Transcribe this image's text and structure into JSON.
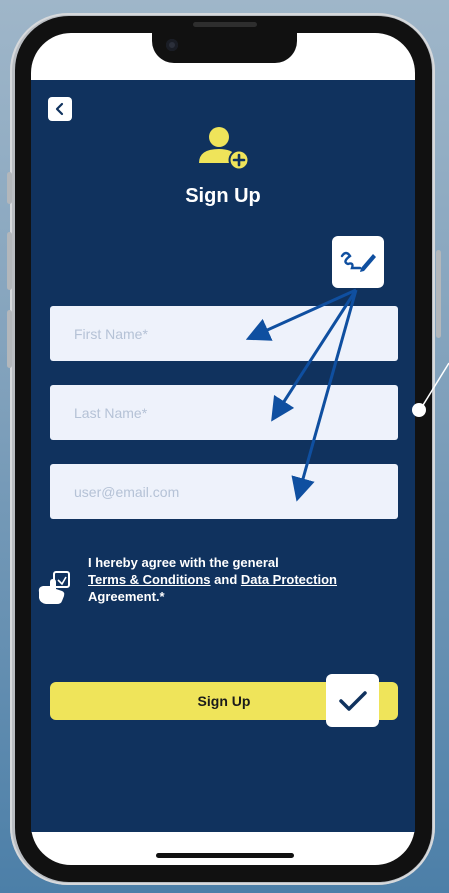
{
  "screen": {
    "title": "Sign Up",
    "back_icon": "chevron-left-icon",
    "header_icon": "user-add-icon"
  },
  "form": {
    "first_name": {
      "placeholder": "First Name*",
      "value": ""
    },
    "last_name": {
      "placeholder": "Last Name*",
      "value": ""
    },
    "email": {
      "placeholder": "user@email.com",
      "value": ""
    }
  },
  "consent": {
    "line1": "I hereby agree with the general",
    "terms_link": "Terms & Conditions",
    "and": " and ",
    "privacy_link": "Data Protection",
    "line3": "Agreement.*",
    "checked": false
  },
  "submit": {
    "label": "Sign Up"
  },
  "annotations": {
    "edit_icon": "pen-signature-icon",
    "tap_icon": "pointing-hand-icon",
    "confirm_icon": "checkmark-icon"
  },
  "colors": {
    "app_background": "#10325e",
    "accent": "#efe45a",
    "input_background": "#eef2fb",
    "annotation_blue": "#0f4fa0"
  }
}
